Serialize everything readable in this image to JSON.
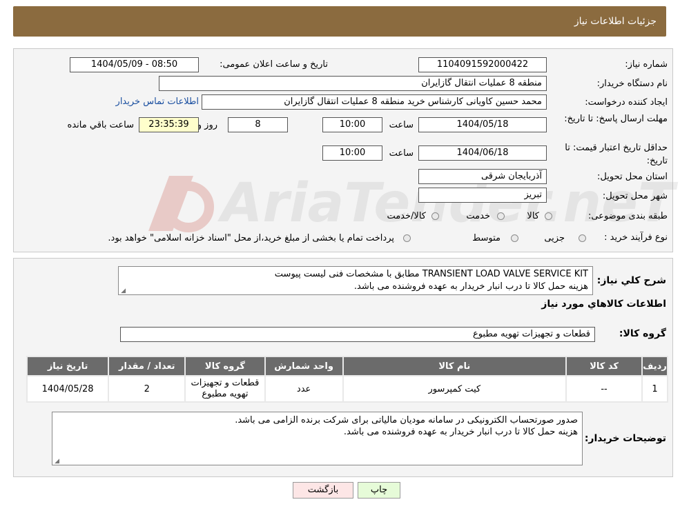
{
  "header": {
    "title": "جزئیات اطلاعات نیاز"
  },
  "fields": {
    "need_number_label": "شماره نیاز:",
    "need_number": "1104091592000422",
    "announce_label": "تاریخ و ساعت اعلان عمومی:",
    "announce_value": "1404/05/09 - 08:50",
    "buyer_org_label": "نام دستگاه خریدار:",
    "buyer_org": "منطقه 8 عملیات انتقال گازایران",
    "creator_label": "ایجاد کننده درخواست:",
    "creator": "محمد حسین کاویانی کارشناس خرید منطقه 8 عملیات انتقال گازایران",
    "contact_link": "اطلاعات تماس خریدار",
    "deadline_label": "مهلت ارسال پاسخ: تا تاریخ:",
    "deadline_date": "1404/05/18",
    "time_label": "ساعت",
    "deadline_time": "10:00",
    "days_value": "8",
    "days_label": "روز و",
    "remaining_time": "23:35:39",
    "remaining_label": "ساعت باقي مانده",
    "validity_label": "حداقل تاریخ اعتبار قیمت: تا تاریخ:",
    "validity_date": "1404/06/18",
    "validity_time": "10:00",
    "province_label": "استان محل تحویل:",
    "province": "آذربایجان شرقی",
    "city_label": "شهر محل تحویل:",
    "city": "تبریز",
    "category_label": "طبقه بندی موضوعی:",
    "category_options": [
      "کالا",
      "خدمت",
      "کالا/خدمت"
    ],
    "process_label": "نوع فرآیند خرید :",
    "process_options": [
      "جزیی",
      "متوسط"
    ],
    "process_note": "پرداخت تمام یا بخشی از مبلغ خرید،از محل \"اسناد خزانه اسلامی\" خواهد بود."
  },
  "description": {
    "label": "شرح کلي نياز:",
    "line1": "TRANSIENT LOAD VALVE SERVICE KIT مطابق با مشخصات فنی لیست پیوست",
    "line2": "هزینه حمل کالا تا درب انبار خریدار به عهده فروشنده می باشد."
  },
  "goods": {
    "section_title": "اطلاعات کالاهاي مورد نياز",
    "group_label": "گروه کالا:",
    "group_value": "قطعات و تجهیزات تهویه مطبوع",
    "columns": [
      "رديف",
      "کد کالا",
      "نام کالا",
      "واحد شمارش",
      "گروه کالا",
      "تعداد / مقدار",
      "تاريخ نياز"
    ],
    "rows": [
      {
        "row": "1",
        "code": "--",
        "name": "کیت کمپرسور",
        "unit": "عدد",
        "group": "قطعات و تجهیزات تهویه مطبوع",
        "qty": "2",
        "date": "1404/05/28"
      }
    ]
  },
  "buyer_notes": {
    "label": "توضیحات خریدار:",
    "line1": "صدور صورتحساب الکترونیکی در سامانه مودیان مالیاتی برای شرکت برنده الزامی می باشد.",
    "line2": "هزینه حمل کالا تا درب انبار خریدار به عهده فروشنده می باشد."
  },
  "buttons": {
    "print": "چاپ",
    "back": "بازگشت"
  },
  "watermark": {
    "text": "AriaTender.neT"
  },
  "colors": {
    "header_bg": "#8b6b3f",
    "table_header_bg": "#6b6b6b",
    "print_bg": "#e6fbd8",
    "back_bg": "#fde6e6"
  }
}
